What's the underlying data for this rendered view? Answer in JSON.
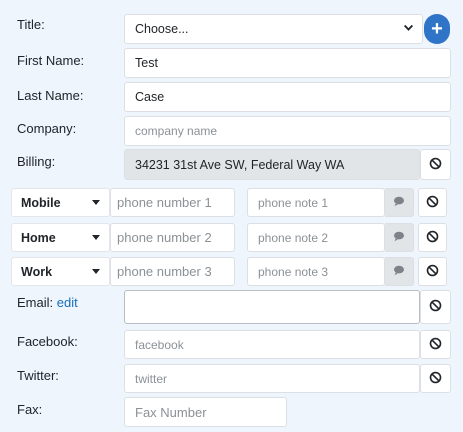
{
  "title": {
    "label": "Title:",
    "value": "Choose..."
  },
  "first_name": {
    "label": "First Name:",
    "value": "Test"
  },
  "last_name": {
    "label": "Last Name:",
    "value": "Case"
  },
  "company": {
    "label": "Company:",
    "placeholder": "company name"
  },
  "billing": {
    "label": "Billing:",
    "value": "34231 31st Ave SW, Federal Way WA"
  },
  "phones": [
    {
      "type": "Mobile",
      "placeholder": "phone number 1",
      "note_placeholder": "phone note 1"
    },
    {
      "type": "Home",
      "placeholder": "phone number 2",
      "note_placeholder": "phone note 2"
    },
    {
      "type": "Work",
      "placeholder": "phone number 3",
      "note_placeholder": "phone note 3"
    }
  ],
  "email": {
    "label": "Email:",
    "edit_link": "edit",
    "value": ""
  },
  "facebook": {
    "label": "Facebook:",
    "placeholder": "facebook"
  },
  "twitter": {
    "label": "Twitter:",
    "placeholder": "twitter"
  },
  "fax": {
    "label": "Fax:",
    "placeholder": "Fax Number"
  },
  "colors": {
    "accent": "#2f74c7",
    "link": "#1a6fb8",
    "background": "#eef5fc",
    "disabled_field": "#e2e5e8"
  },
  "icons": {
    "add": "plus-icon",
    "clear": "ban-icon",
    "note": "comment-icon",
    "dropdown": "chevron-down-icon"
  }
}
